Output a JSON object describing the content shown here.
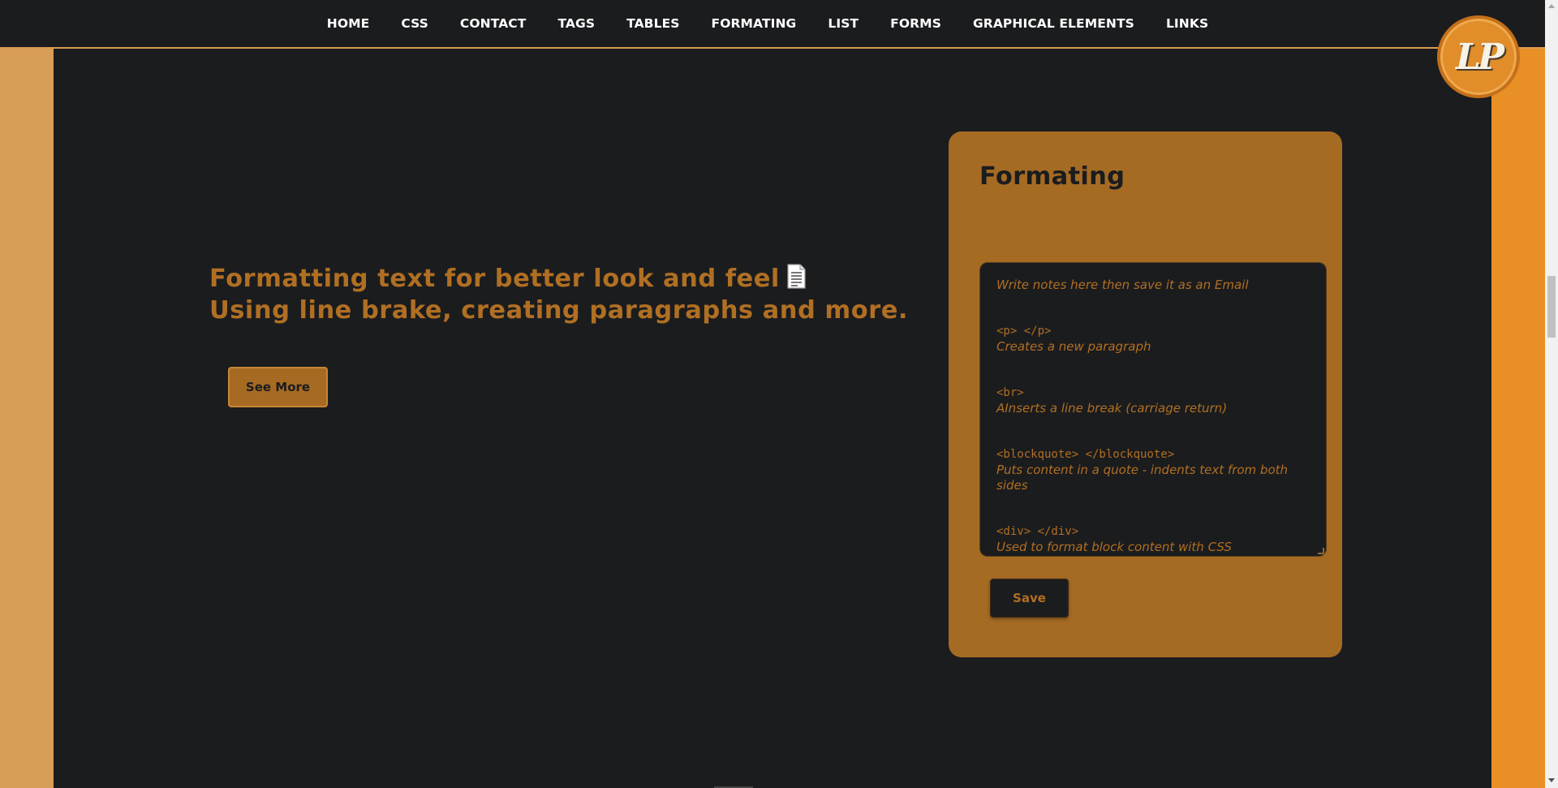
{
  "nav": {
    "items": [
      {
        "label": "HOME"
      },
      {
        "label": "CSS"
      },
      {
        "label": "CONTACT"
      },
      {
        "label": "TAGS"
      },
      {
        "label": "TABLES"
      },
      {
        "label": "FORMATING"
      },
      {
        "label": "LIST"
      },
      {
        "label": "FORMS"
      },
      {
        "label": "GRAPHICAL ELEMENTS"
      },
      {
        "label": "LINKS"
      }
    ]
  },
  "logo": {
    "text": "LP"
  },
  "hero": {
    "line1": "Formatting text for better look and feel",
    "line1_icon": "document-icon",
    "line2": "Using line brake, creating paragraphs and more.",
    "button_label": "See More"
  },
  "card": {
    "title": "Formating",
    "notes": {
      "placeholder": "Write notes here then save it as an Email",
      "entries": [
        {
          "tag": "<p> </p>",
          "desc": "Creates a new paragraph"
        },
        {
          "tag": "<br>",
          "desc": "AInserts a line break (carriage return)"
        },
        {
          "tag": "<blockquote> </blockquote>",
          "desc": "Puts content in a quote - indents text from both sides"
        },
        {
          "tag": "<div> </div>",
          "desc": "Used to format block content with CSS"
        }
      ]
    },
    "save_label": "Save"
  },
  "colors": {
    "background": "#1b1c1e",
    "accent": "#a56b23",
    "text_accent": "#b06f23",
    "left_band": "#d89e57",
    "right_band": "#e88f25"
  }
}
